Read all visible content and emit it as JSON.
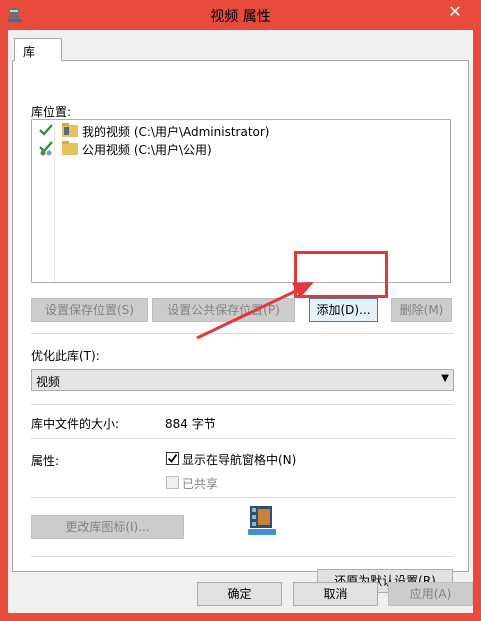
{
  "window": {
    "title": "视频 属性",
    "close_glyph": "✕"
  },
  "tabs": [
    {
      "label": "库"
    }
  ],
  "library": {
    "locations_label": "库位置:",
    "locations": [
      {
        "status": "checkmark-icon",
        "text": "我的视频 (C:\\用户\\Administrator)"
      },
      {
        "status": "shared-checkmark-icon",
        "text": "公用视频 (C:\\用户\\公用)"
      }
    ],
    "buttons": {
      "set_save": "设置保存位置(S)",
      "set_public_save": "设置公共保存位置(P)",
      "add": "添加(D)...",
      "remove": "删除(M)"
    },
    "optimize_label": "优化此库(T):",
    "optimize_value": "视频",
    "size_label": "库中文件的大小:",
    "size_value": "884 字节",
    "attributes_label": "属性:",
    "show_in_nav": "显示在导航窗格中(N)",
    "show_in_nav_checked": true,
    "shared": "已共享",
    "shared_checked": false,
    "change_icon": "更改库图标(I)...",
    "restore_defaults": "还原为默认设置(R)"
  },
  "footer": {
    "ok": "确定",
    "cancel": "取消",
    "apply": "应用(A)"
  },
  "annotation": {
    "color": "#e8373a"
  }
}
